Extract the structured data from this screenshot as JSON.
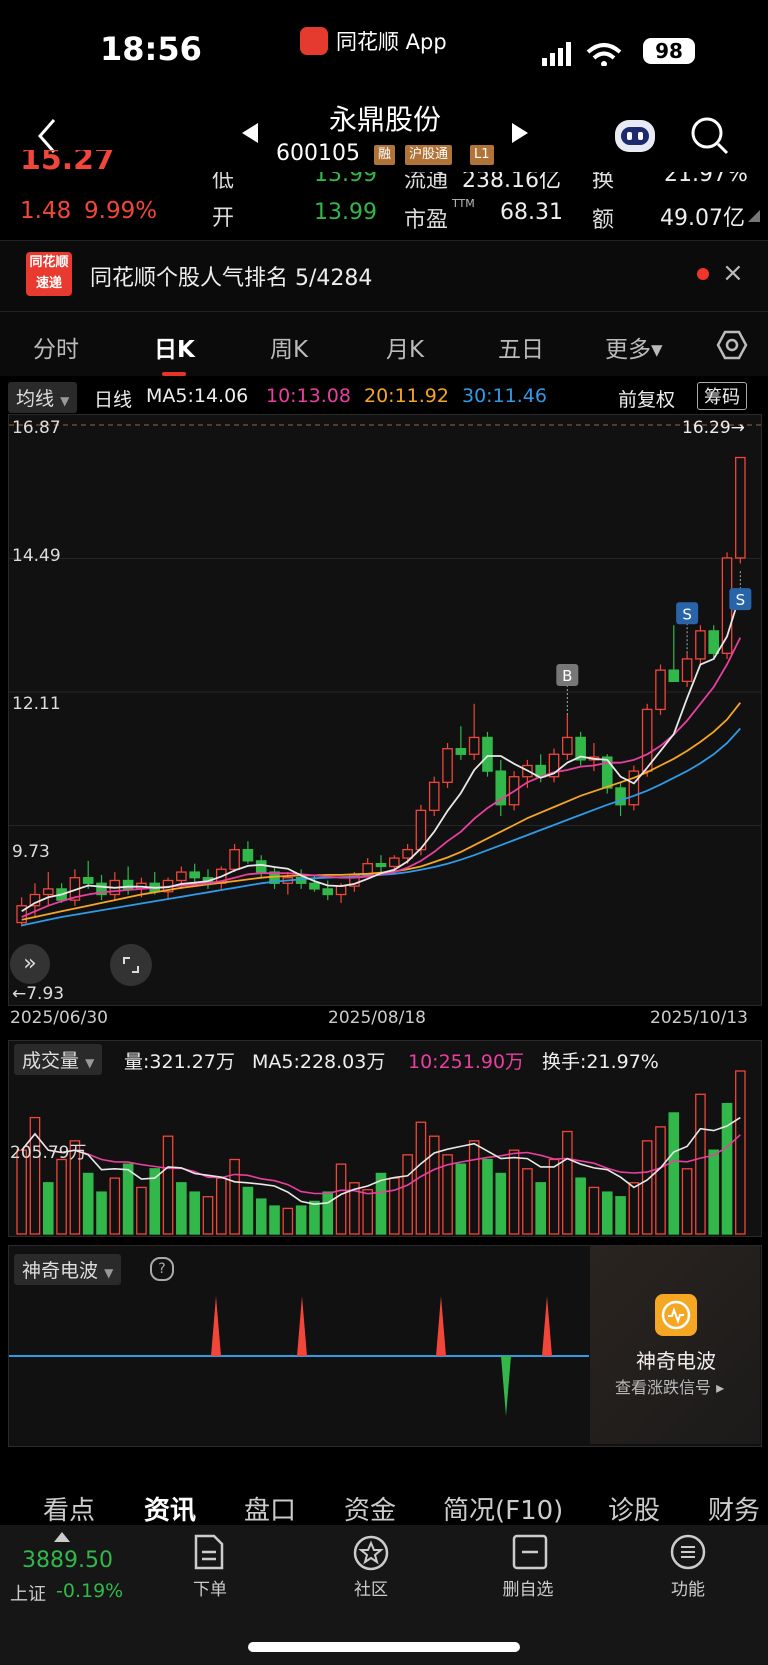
{
  "status": {
    "time": "18:56",
    "app_name": "同花顺 App",
    "battery": "98"
  },
  "nav": {
    "title": "永鼎股份",
    "code": "600105",
    "tags": [
      "融",
      "沪股通",
      "L1"
    ]
  },
  "quote": {
    "price_partial": "15.27",
    "change": "1.48",
    "change_pct": "9.99%",
    "low_label": "低",
    "low": "13.99",
    "open_label": "开",
    "open": "13.99",
    "float_label": "流通",
    "float": "238.16亿",
    "pe_label": "市盈",
    "pe_sup": "TTM",
    "pe": "68.31",
    "turn_label": "换",
    "turn": "21.97%",
    "amount_label": "额",
    "amount": "49.07亿"
  },
  "news": {
    "logo_top": "同花顺",
    "logo_bottom": "速递",
    "text": "同花顺个股人气排名 5/4284",
    "close": "×"
  },
  "tabs": [
    "分时",
    "日K",
    "周K",
    "月K",
    "五日",
    "更多▾"
  ],
  "ma_row": {
    "type": "均线",
    "period": "日线",
    "ma5": "MA5:14.06",
    "ma10": "10:13.08",
    "ma20": "20:11.92",
    "ma30": "30:11.46",
    "adjust": "前复权",
    "chip": "筹码"
  },
  "colors": {
    "up": "#f2463a",
    "down": "#32b84a",
    "ma5": "#e8e8e8",
    "ma10": "#e83fa0",
    "ma20": "#f5a623",
    "ma30": "#2f9be8",
    "bg": "#111111"
  },
  "chart_data": {
    "type": "candlestick",
    "y_ticks": [
      "16.87",
      "14.49",
      "12.11",
      "9.73"
    ],
    "y_range": [
      7.6,
      16.87
    ],
    "x_labels": [
      "2025/06/30",
      "2025/08/18",
      "2025/10/13"
    ],
    "max_label": "16.29→",
    "min_label": "←7.93",
    "signal_b": "B",
    "signal_s": "S",
    "candles": [
      [
        8.0,
        8.45,
        7.93,
        8.3
      ],
      [
        8.3,
        8.7,
        8.1,
        8.5
      ],
      [
        8.5,
        8.9,
        8.3,
        8.6
      ],
      [
        8.6,
        8.7,
        8.35,
        8.4
      ],
      [
        8.4,
        8.95,
        8.3,
        8.8
      ],
      [
        8.8,
        9.1,
        8.6,
        8.7
      ],
      [
        8.7,
        8.85,
        8.4,
        8.5
      ],
      [
        8.5,
        8.9,
        8.4,
        8.75
      ],
      [
        8.75,
        9.0,
        8.5,
        8.6
      ],
      [
        8.6,
        8.8,
        8.45,
        8.7
      ],
      [
        8.7,
        8.9,
        8.5,
        8.55
      ],
      [
        8.55,
        8.8,
        8.4,
        8.75
      ],
      [
        8.75,
        9.0,
        8.6,
        8.9
      ],
      [
        8.9,
        9.05,
        8.7,
        8.8
      ],
      [
        8.8,
        8.95,
        8.6,
        8.7
      ],
      [
        8.7,
        9.0,
        8.6,
        8.95
      ],
      [
        8.95,
        9.4,
        8.9,
        9.3
      ],
      [
        9.3,
        9.45,
        9.05,
        9.1
      ],
      [
        9.1,
        9.2,
        8.8,
        8.9
      ],
      [
        8.9,
        9.0,
        8.6,
        8.7
      ],
      [
        8.7,
        8.9,
        8.5,
        8.8
      ],
      [
        8.8,
        8.95,
        8.6,
        8.7
      ],
      [
        8.7,
        8.85,
        8.55,
        8.6
      ],
      [
        8.6,
        8.75,
        8.4,
        8.5
      ],
      [
        8.5,
        8.7,
        8.35,
        8.65
      ],
      [
        8.65,
        8.9,
        8.55,
        8.85
      ],
      [
        8.85,
        9.15,
        8.8,
        9.05
      ],
      [
        9.05,
        9.2,
        8.9,
        9.0
      ],
      [
        9.0,
        9.2,
        8.9,
        9.15
      ],
      [
        9.15,
        9.4,
        9.05,
        9.3
      ],
      [
        9.3,
        10.1,
        9.2,
        10.0
      ],
      [
        10.0,
        10.6,
        9.9,
        10.5
      ],
      [
        10.5,
        11.2,
        10.4,
        11.1
      ],
      [
        11.1,
        11.5,
        10.9,
        11.0
      ],
      [
        11.0,
        11.9,
        10.9,
        11.3
      ],
      [
        11.3,
        11.4,
        10.6,
        10.7
      ],
      [
        10.7,
        10.9,
        9.9,
        10.1
      ],
      [
        10.1,
        10.7,
        10.0,
        10.6
      ],
      [
        10.6,
        10.9,
        10.4,
        10.8
      ],
      [
        10.8,
        11.0,
        10.5,
        10.6
      ],
      [
        10.6,
        11.1,
        10.5,
        11.0
      ],
      [
        11.0,
        11.7,
        10.9,
        11.3
      ],
      [
        11.3,
        11.4,
        10.8,
        10.9
      ],
      [
        10.9,
        11.2,
        10.7,
        10.95
      ],
      [
        10.95,
        11.0,
        10.3,
        10.4
      ],
      [
        10.4,
        10.5,
        9.9,
        10.1
      ],
      [
        10.1,
        10.8,
        10.0,
        10.7
      ],
      [
        10.7,
        11.9,
        10.6,
        11.8
      ],
      [
        11.8,
        12.6,
        11.7,
        12.5
      ],
      [
        12.5,
        13.3,
        12.3,
        12.3
      ],
      [
        12.3,
        12.8,
        12.2,
        12.7
      ],
      [
        12.7,
        13.3,
        12.6,
        13.2
      ],
      [
        13.2,
        13.3,
        12.7,
        12.8
      ],
      [
        12.8,
        14.6,
        12.7,
        14.5
      ],
      [
        14.5,
        16.29,
        14.4,
        16.29
      ]
    ],
    "ma5": [
      8.2,
      8.35,
      8.45,
      8.5,
      8.58,
      8.66,
      8.64,
      8.62,
      8.64,
      8.64,
      8.62,
      8.63,
      8.69,
      8.71,
      8.74,
      8.82,
      8.93,
      9.01,
      9.03,
      8.99,
      8.96,
      8.84,
      8.74,
      8.66,
      8.65,
      8.69,
      8.78,
      8.88,
      8.94,
      9.09,
      9.32,
      9.62,
      9.99,
      10.31,
      10.72,
      10.97,
      10.97,
      10.83,
      10.71,
      10.58,
      10.66,
      10.85,
      10.96,
      10.92,
      10.9,
      10.6,
      10.48,
      10.76,
      11.06,
      11.36,
      12.0,
      12.6,
      12.7,
      13.1,
      13.86
    ],
    "ma10": [
      8.1,
      8.2,
      8.3,
      8.38,
      8.45,
      8.5,
      8.54,
      8.56,
      8.58,
      8.6,
      8.62,
      8.64,
      8.66,
      8.68,
      8.7,
      8.74,
      8.8,
      8.86,
      8.88,
      8.88,
      8.88,
      8.86,
      8.84,
      8.82,
      8.8,
      8.8,
      8.82,
      8.86,
      8.9,
      8.98,
      9.1,
      9.26,
      9.45,
      9.62,
      9.85,
      10.04,
      10.2,
      10.34,
      10.5,
      10.6,
      10.68,
      10.72,
      10.78,
      10.8,
      10.85,
      10.85,
      10.9,
      11.0,
      11.15,
      11.35,
      11.6,
      11.9,
      12.2,
      12.6,
      13.08
    ],
    "ma20": [
      8.05,
      8.1,
      8.15,
      8.2,
      8.25,
      8.3,
      8.35,
      8.4,
      8.45,
      8.5,
      8.54,
      8.58,
      8.62,
      8.65,
      8.68,
      8.71,
      8.74,
      8.77,
      8.8,
      8.82,
      8.83,
      8.84,
      8.84,
      8.85,
      8.85,
      8.86,
      8.87,
      8.89,
      8.91,
      8.95,
      9.0,
      9.08,
      9.16,
      9.26,
      9.38,
      9.5,
      9.62,
      9.74,
      9.86,
      9.96,
      10.06,
      10.16,
      10.26,
      10.34,
      10.42,
      10.5,
      10.58,
      10.68,
      10.8,
      10.92,
      11.06,
      11.22,
      11.4,
      11.62,
      11.92
    ],
    "ma30": [
      7.95,
      8.0,
      8.05,
      8.1,
      8.14,
      8.18,
      8.22,
      8.26,
      8.3,
      8.34,
      8.38,
      8.42,
      8.46,
      8.5,
      8.54,
      8.58,
      8.62,
      8.66,
      8.7,
      8.73,
      8.75,
      8.77,
      8.79,
      8.8,
      8.81,
      8.82,
      8.83,
      8.85,
      8.87,
      8.9,
      8.94,
      8.99,
      9.05,
      9.12,
      9.2,
      9.29,
      9.38,
      9.47,
      9.56,
      9.65,
      9.74,
      9.83,
      9.92,
      10.01,
      10.1,
      10.18,
      10.26,
      10.35,
      10.46,
      10.58,
      10.7,
      10.84,
      11.0,
      11.2,
      11.46
    ]
  },
  "volume": {
    "label": "成交量",
    "vol": "量:321.27万",
    "ma5": "MA5:228.03万",
    "ma10": "10:251.90万",
    "turnover": "换手:21.97%",
    "axis": "205.79万",
    "values": [
      180,
      250,
      110,
      160,
      200,
      130,
      90,
      120,
      150,
      100,
      140,
      210,
      110,
      90,
      80,
      120,
      160,
      100,
      75,
      60,
      55,
      60,
      70,
      90,
      150,
      110,
      95,
      130,
      120,
      170,
      240,
      210,
      170,
      150,
      200,
      160,
      130,
      180,
      140,
      110,
      160,
      220,
      120,
      100,
      90,
      80,
      110,
      200,
      230,
      260,
      140,
      300,
      180,
      280,
      350
    ],
    "ups": [
      1,
      1,
      0,
      1,
      1,
      0,
      0,
      1,
      0,
      1,
      0,
      1,
      0,
      0,
      1,
      1,
      1,
      0,
      0,
      0,
      1,
      0,
      0,
      0,
      1,
      1,
      1,
      0,
      1,
      1,
      1,
      1,
      1,
      0,
      1,
      0,
      0,
      1,
      1,
      0,
      1,
      1,
      0,
      1,
      0,
      0,
      1,
      1,
      1,
      0,
      1,
      1,
      0,
      0,
      1
    ]
  },
  "wave": {
    "label": "神奇电波",
    "help": "?",
    "promo_title": "神奇电波",
    "promo_sub": "查看涨跌信号 ▸"
  },
  "bottom_tabs": [
    "看点",
    "资讯",
    "盘口",
    "资金",
    "简况(F10)",
    "诊股",
    "财务"
  ],
  "bottom_nav": {
    "index_value": "3889.50",
    "index_name": "上证",
    "index_change": "-0.19%",
    "items": [
      "下单",
      "社区",
      "删自选",
      "功能"
    ]
  }
}
